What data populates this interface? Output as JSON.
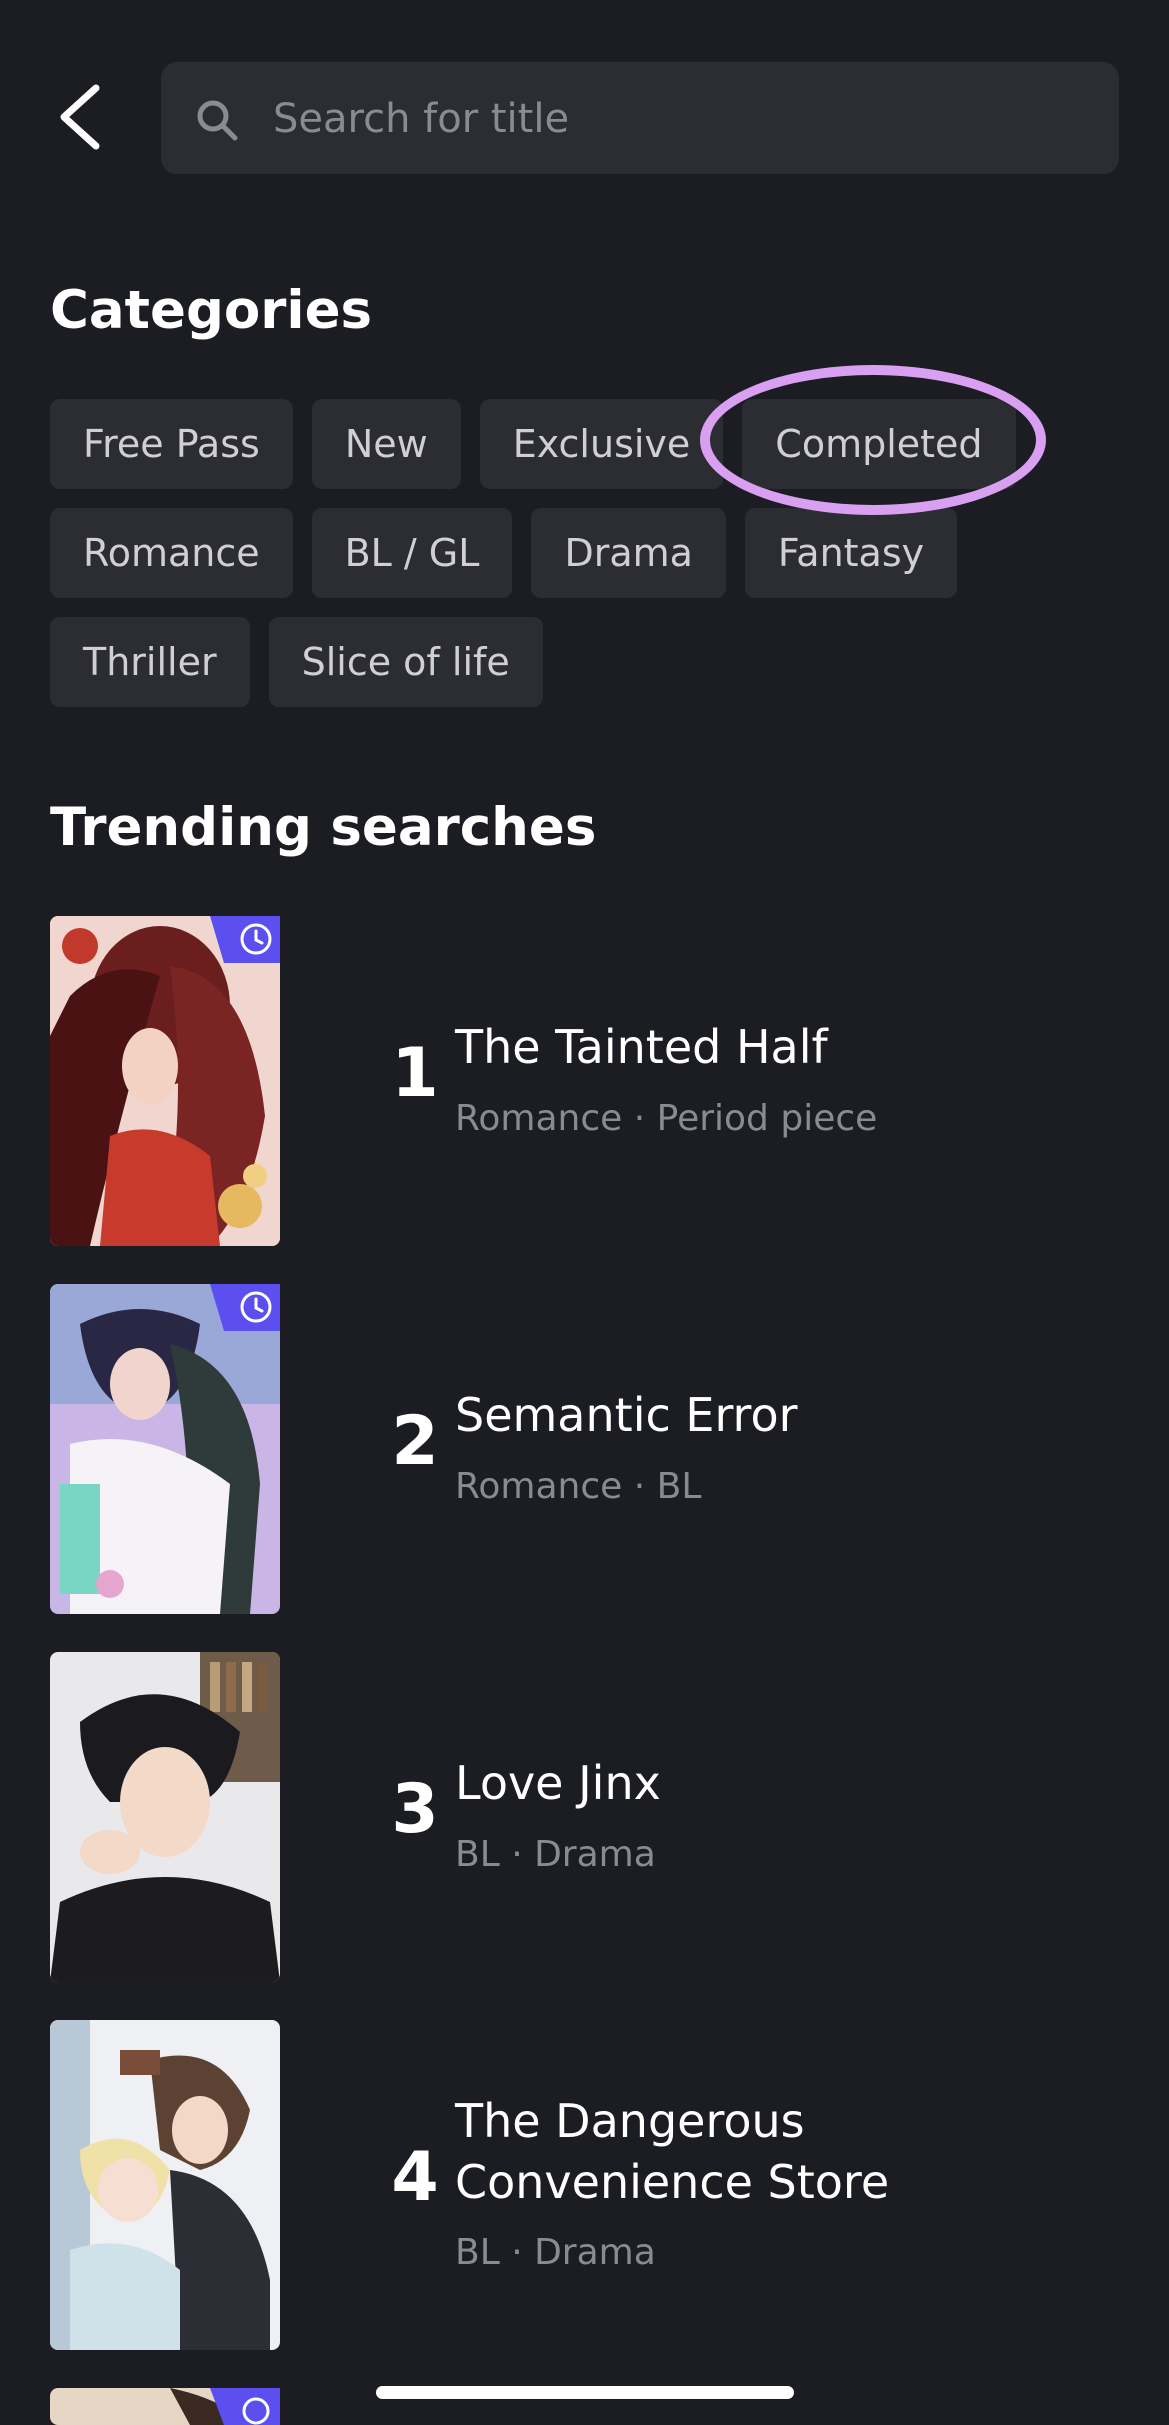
{
  "header": {
    "search_placeholder": "Search for title"
  },
  "categories": {
    "title": "Categories",
    "rows": [
      [
        "Free Pass",
        "New",
        "Exclusive",
        "Completed"
      ],
      [
        "Romance",
        "BL / GL",
        "Drama",
        "Fantasy"
      ],
      [
        "Thriller",
        "Slice of life"
      ]
    ],
    "highlighted": "Completed",
    "highlight_color": "#d9a0f2"
  },
  "trending": {
    "title": "Trending searches",
    "items": [
      {
        "rank": "1",
        "title_lines": [
          "The Tainted Half"
        ],
        "genres": "Romance · Period piece",
        "badge": "clock-icon"
      },
      {
        "rank": "2",
        "title_lines": [
          "Semantic Error"
        ],
        "genres": "Romance · BL",
        "badge": "clock-icon"
      },
      {
        "rank": "3",
        "title_lines": [
          "Love Jinx"
        ],
        "genres": "BL · Drama",
        "badge": ""
      },
      {
        "rank": "4",
        "title_lines": [
          "The Dangerous",
          "Convenience Store"
        ],
        "genres": "BL · Drama",
        "badge": ""
      }
    ]
  },
  "colors": {
    "background": "#1c1d22",
    "chip_bg": "#2c2d33",
    "badge": "#5b4ff0",
    "muted_text": "#8a8b91"
  }
}
